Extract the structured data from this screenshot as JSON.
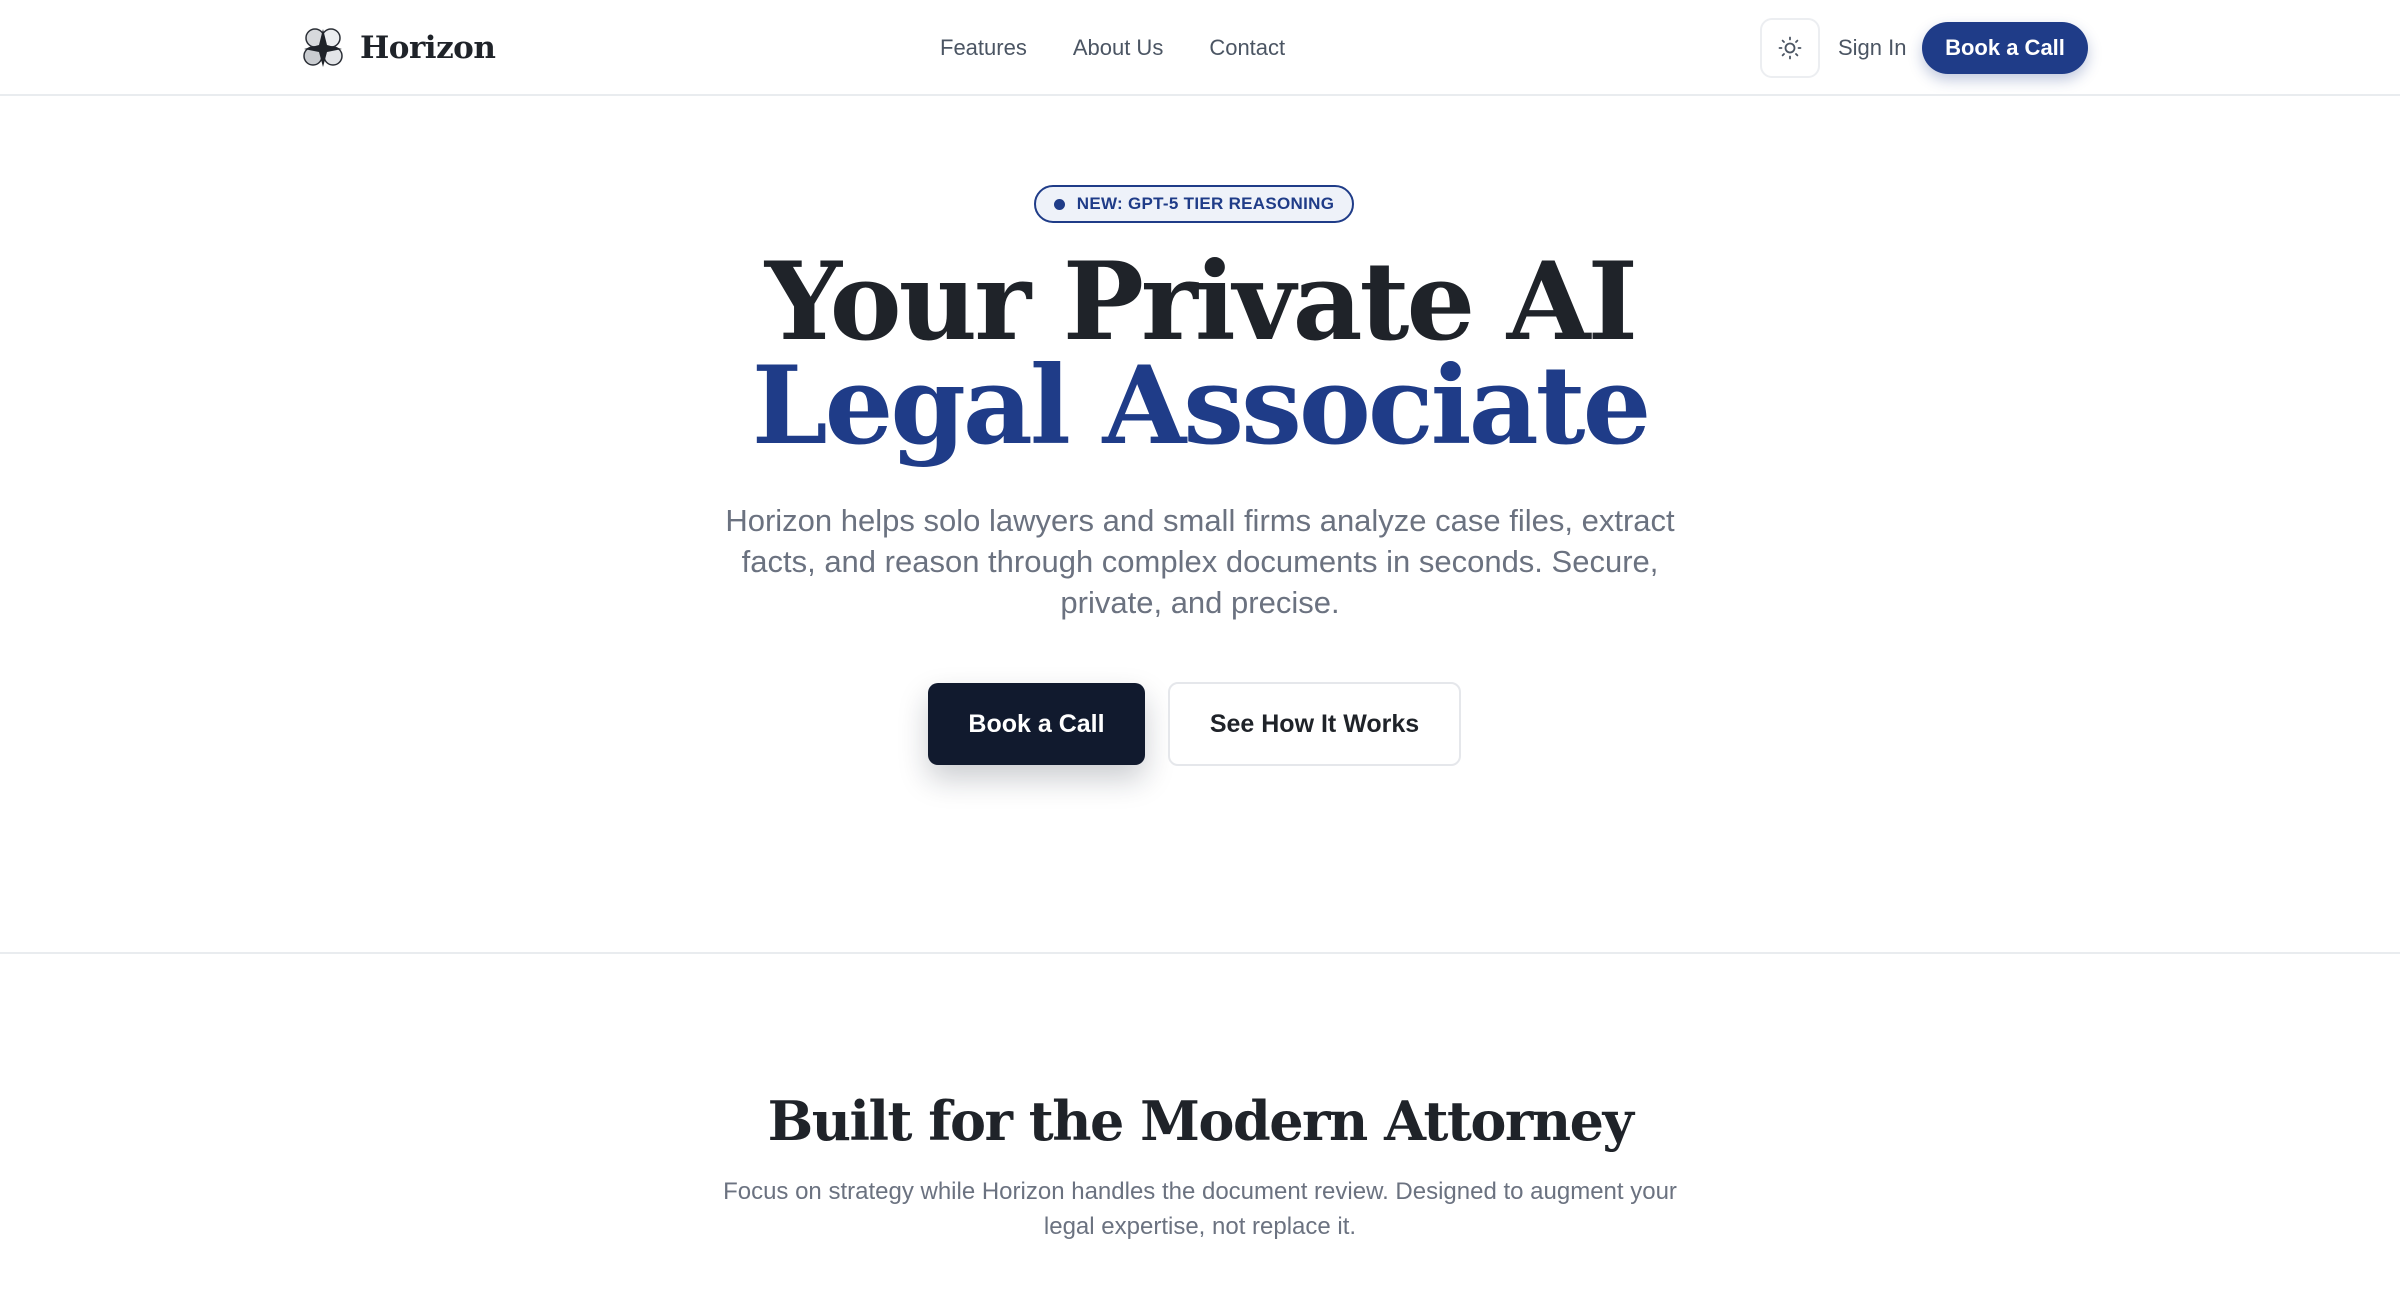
{
  "header": {
    "brand_name": "Horizon",
    "nav": [
      {
        "label": "Features"
      },
      {
        "label": "About Us"
      },
      {
        "label": "Contact"
      }
    ],
    "theme_toggle_icon": "sun-icon",
    "sign_in_label": "Sign In",
    "book_call_label": "Book a Call"
  },
  "hero": {
    "badge_text": "NEW: GPT-5 TIER REASONING",
    "title_line1": "Your Private AI",
    "title_line2": "Legal Associate",
    "subtitle": "Horizon helps solo lawyers and small firms analyze case files, extract facts, and reason through complex documents in seconds. Secure, private, and precise.",
    "primary_cta": "Book a Call",
    "secondary_cta": "See How It Works"
  },
  "section": {
    "title": "Built for the Modern Attorney",
    "subtitle": "Focus on strategy while Horizon handles the document review. Designed to augment your legal expertise, not replace it."
  },
  "colors": {
    "accent": "#1f3c88",
    "dark_button": "#111a2e",
    "heading": "#1f2329",
    "muted_text": "#6b7280"
  }
}
